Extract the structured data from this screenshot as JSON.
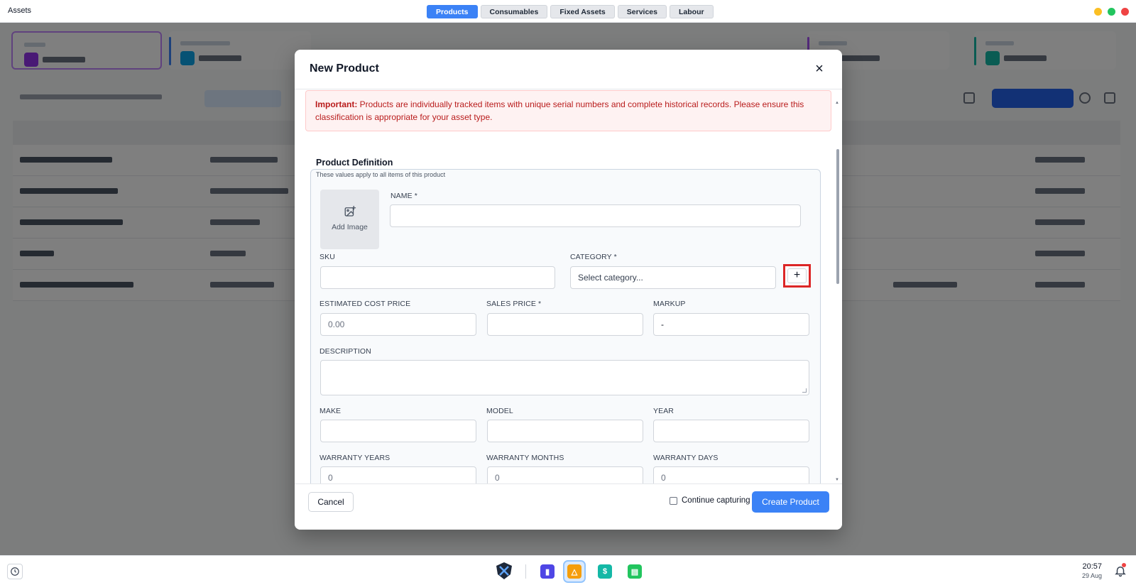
{
  "app": {
    "title": "Assets"
  },
  "tabs": [
    {
      "label": "Products",
      "active": true
    },
    {
      "label": "Consumables",
      "active": false
    },
    {
      "label": "Fixed Assets",
      "active": false
    },
    {
      "label": "Services",
      "active": false
    },
    {
      "label": "Labour",
      "active": false
    }
  ],
  "window_controls": {
    "minimize_color": "#fbbf24",
    "maximize_color": "#22c55e",
    "close_color": "#ef4444"
  },
  "modal": {
    "title": "New Product",
    "close_icon": "close-icon",
    "alert": {
      "strong": "Important:",
      "text": " Products are individually tracked items with unique serial numbers and complete historical records. Please ensure this classification is appropriate for your asset type."
    },
    "section": {
      "title": "Product Definition",
      "subtitle": "These values apply to all items of this product"
    },
    "add_image_label": "Add Image",
    "fields": {
      "name": {
        "label": "NAME *",
        "value": ""
      },
      "sku": {
        "label": "SKU",
        "value": ""
      },
      "category": {
        "label": "CATEGORY *",
        "placeholder": "Select category...",
        "add_label": "+"
      },
      "estimated_cost_price": {
        "label": "ESTIMATED COST PRICE",
        "placeholder": "0.00"
      },
      "sales_price": {
        "label": "SALES PRICE *",
        "value": ""
      },
      "markup": {
        "label": "MARKUP",
        "value": "-"
      },
      "description": {
        "label": "DESCRIPTION",
        "value": ""
      },
      "make": {
        "label": "MAKE",
        "value": ""
      },
      "model": {
        "label": "MODEL",
        "value": ""
      },
      "year": {
        "label": "YEAR",
        "value": ""
      },
      "warranty_years": {
        "label": "WARRANTY YEARS",
        "placeholder": "0"
      },
      "warranty_months": {
        "label": "WARRANTY MONTHS",
        "placeholder": "0"
      },
      "warranty_days": {
        "label": "WARRANTY DAYS",
        "placeholder": "0"
      }
    },
    "footer": {
      "cancel_label": "Cancel",
      "continue_label": "Continue capturing",
      "continue_checked": false,
      "create_label": "Create Product"
    }
  },
  "taskbar": {
    "time": "20:57",
    "date": "29 Aug",
    "notification_badge": true
  }
}
